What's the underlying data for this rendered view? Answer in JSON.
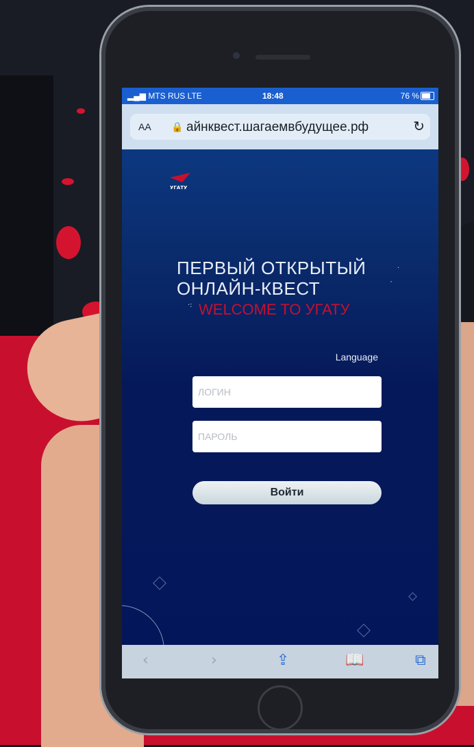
{
  "status_bar": {
    "carrier": "MTS RUS",
    "network": "LTE",
    "time": "18:48",
    "battery": "76 %"
  },
  "browser": {
    "aa_label": "AA",
    "url": "айнквест.шагаемвбудущее.рф",
    "reload_icon": "↻"
  },
  "page": {
    "logo_text": "УГАТУ",
    "title_line1": "ПЕРВЫЙ ОТКРЫТЫЙ",
    "title_line2": "ОНЛАЙН-КВЕСТ",
    "welcome": "WELCOME TO УГАТУ",
    "language_label": "Language",
    "login_placeholder": "ЛОГИН",
    "password_placeholder": "ПАРОЛЬ",
    "submit_label": "Войти"
  },
  "toolbar": {
    "back_icon": "‹",
    "forward_icon": "›",
    "share_icon": "⇪",
    "bookmarks_icon": "📖",
    "tabs_icon": "⧉"
  },
  "colors": {
    "accent_red": "#c8102e",
    "screen_blue": "#05195a",
    "status_blue": "#1a5fd0"
  }
}
